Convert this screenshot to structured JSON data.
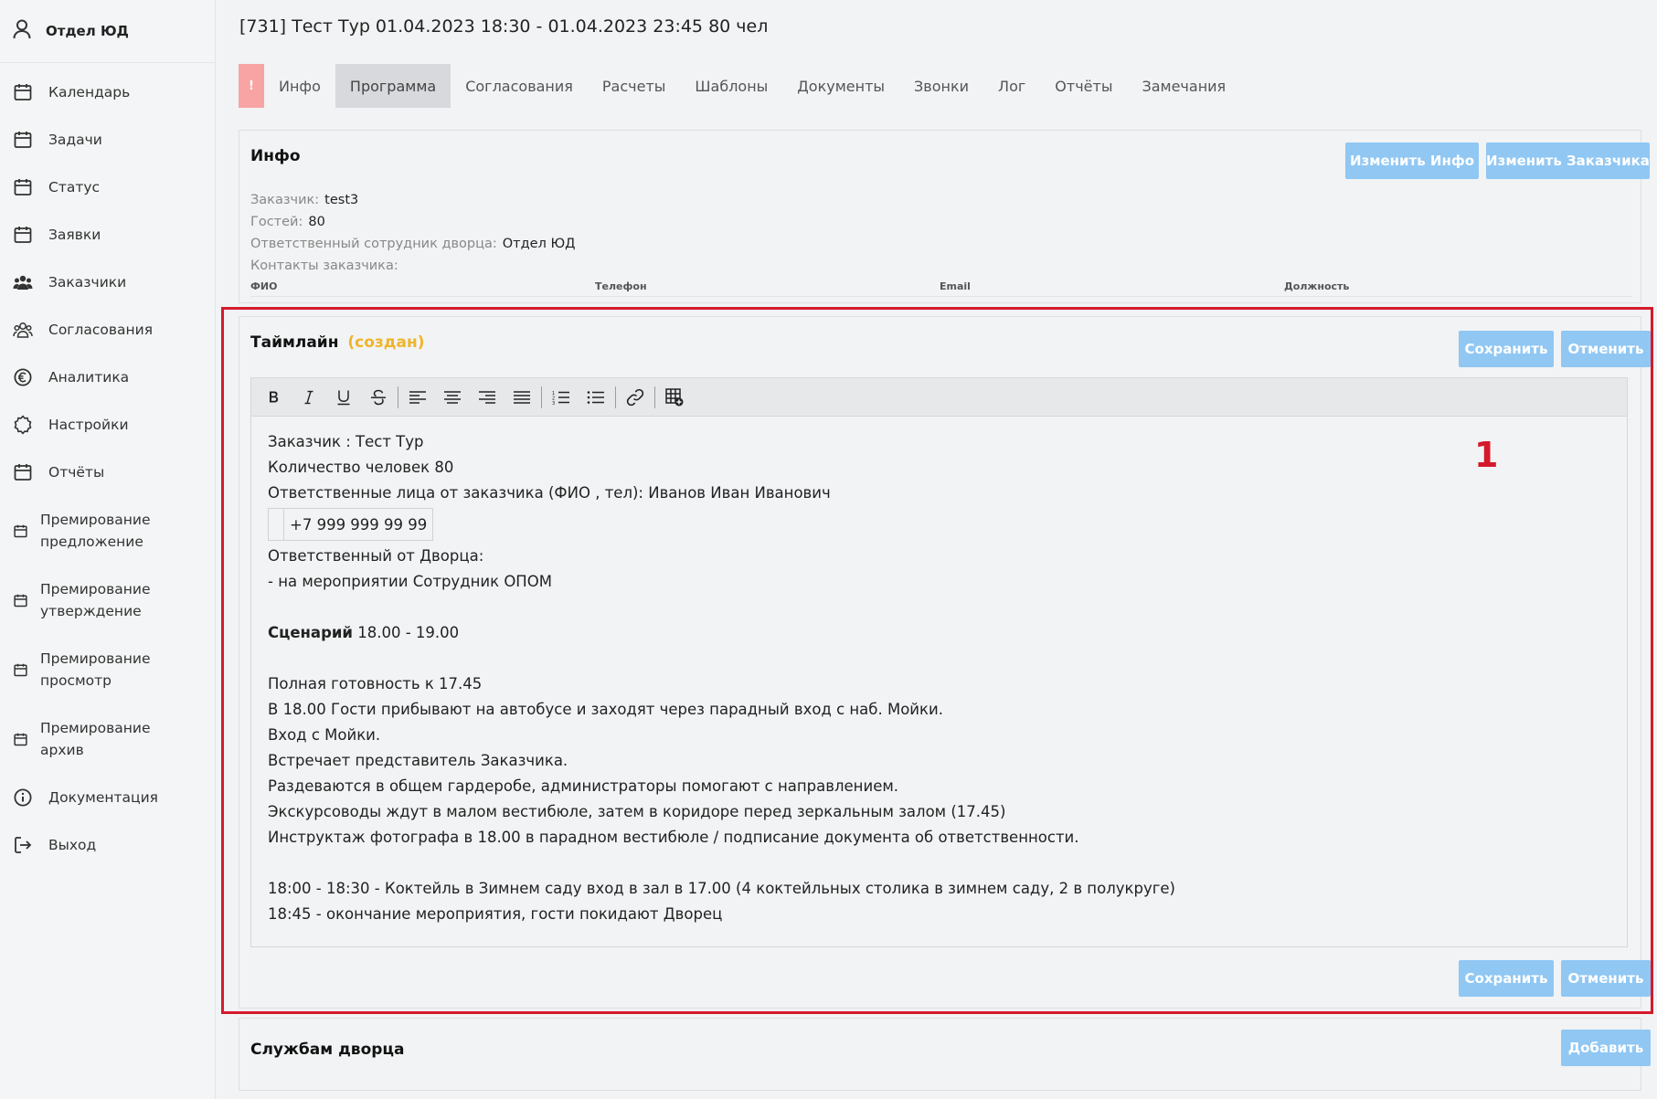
{
  "sidebar": {
    "user": "Отдел ЮД",
    "items": [
      {
        "label": "Календарь",
        "icon": "calendar-icon"
      },
      {
        "label": "Задачи",
        "icon": "calendar-icon"
      },
      {
        "label": "Статус",
        "icon": "calendar-icon"
      },
      {
        "label": "Заявки",
        "icon": "calendar-icon"
      },
      {
        "label": "Заказчики",
        "icon": "users-icon"
      },
      {
        "label": "Согласования",
        "icon": "users-icon"
      },
      {
        "label": "Аналитика",
        "icon": "euro-icon"
      },
      {
        "label": "Настройки",
        "icon": "gear-icon"
      },
      {
        "label": "Отчёты",
        "icon": "calendar-icon"
      },
      {
        "label": "Премирование предложение",
        "icon": "calendar-icon"
      },
      {
        "label": "Премирование утверждение",
        "icon": "calendar-icon"
      },
      {
        "label": "Премирование просмотр",
        "icon": "calendar-icon"
      },
      {
        "label": "Премирование архив",
        "icon": "calendar-icon"
      },
      {
        "label": "Документация",
        "icon": "info-icon"
      },
      {
        "label": "Выход",
        "icon": "logout-icon"
      }
    ]
  },
  "header": {
    "title": "[731] Тест Тур 01.04.2023 18:30 - 01.04.2023 23:45 80 чел"
  },
  "tabs": {
    "alert": "!",
    "items": [
      "Инфо",
      "Программа",
      "Согласования",
      "Расчеты",
      "Шаблоны",
      "Документы",
      "Звонки",
      "Лог",
      "Отчёты",
      "Замечания"
    ],
    "active": "Программа"
  },
  "info_card": {
    "title": "Инфо",
    "edit_info_label": "Изменить Инфо",
    "edit_customer_label": "Изменить Заказчика",
    "customer_key": "Заказчик:",
    "customer_value": "test3",
    "guests_key": "Гостей:",
    "guests_value": "80",
    "responsible_key": "Ответственный сотрудник дворца:",
    "responsible_value": "Отдел ЮД",
    "contacts_key": "Контакты заказчика:",
    "contacts_columns": [
      "ФИО",
      "Телефон",
      "Email",
      "Должность"
    ]
  },
  "timeline_card": {
    "title": "Таймлайн",
    "status": "(создан)",
    "save_label": "Сохранить",
    "cancel_label": "Отменить",
    "marker": "1",
    "editor_lines": {
      "l1": "Заказчик : Тест Тур",
      "l2": "Количество человек 80",
      "l3": "Ответственные лица от заказчика (ФИО , тел): Иванов Иван Иванович",
      "phone": "+7 999 999 99 99",
      "l4": "Ответственный от Дворца:",
      "l5": "- на мероприятии Сотрудник ОПОМ",
      "scenario_bold": "Сценарий",
      "scenario_time": " 18.00 - 19.00",
      "l6": "Полная готовность к 17.45",
      "l7": "В 18.00 Гости прибывают на автобусе и заходят через парадный вход с наб. Мойки.",
      "l8": "Вход с Мойки.",
      "l9": "Встречает представитель Заказчика.",
      "l10": "Раздеваются в общем гардеробе, администраторы помогают с направлением.",
      "l11": "Экскурсоводы ждут в малом вестибюле, затем в коридоре перед зеркальным залом (17.45)",
      "l12": "Инструктаж фотографа в 18.00 в парадном вестибюле / подписание документа об ответственности.",
      "l13": "18:00 - 18:30 - Коктейль в Зимнем саду вход в зал в 17.00 (4 коктейльных столика в зимнем саду, 2 в полукруге)",
      "l14": "18:45 - окончание мероприятия, гости покидают Дворец"
    }
  },
  "services_card": {
    "title": "Службам дворца",
    "add_label": "Добавить"
  },
  "colors": {
    "accent_button": "#90c7f3",
    "highlight": "#d41b2c",
    "status_created": "#f0b429"
  }
}
